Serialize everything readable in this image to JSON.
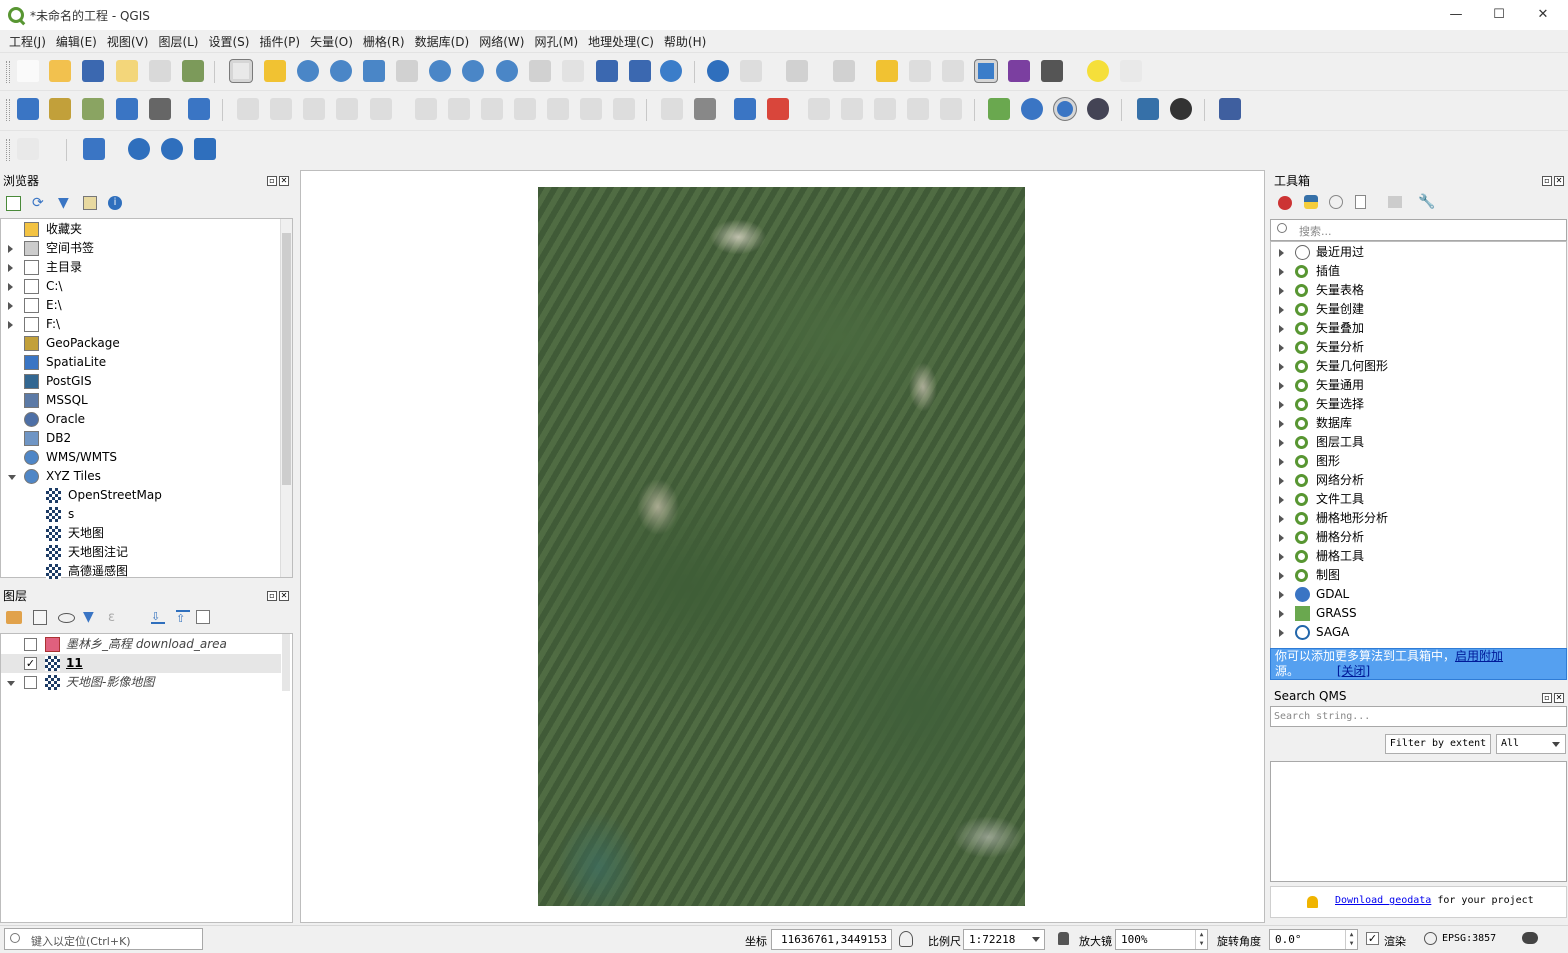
{
  "window": {
    "title": "*未命名的工程 - QGIS",
    "minimize": "—",
    "maximize": "☐",
    "close": "✕"
  },
  "menu": [
    "工程(J)",
    "编辑(E)",
    "视图(V)",
    "图层(L)",
    "设置(S)",
    "插件(P)",
    "矢量(O)",
    "栅格(R)",
    "数据库(D)",
    "网络(W)",
    "网孔(M)",
    "地理处理(C)",
    "帮助(H)"
  ],
  "browser": {
    "title": "浏览器",
    "items": [
      {
        "label": "收藏夹",
        "icon": "star-icon",
        "expand": "none"
      },
      {
        "label": "空间书签",
        "icon": "bookmark-icon",
        "expand": "collapsed"
      },
      {
        "label": "主目录",
        "icon": "home-folder-icon",
        "expand": "collapsed"
      },
      {
        "label": "C:\\",
        "icon": "folder-icon",
        "expand": "collapsed"
      },
      {
        "label": "E:\\",
        "icon": "folder-icon",
        "expand": "collapsed"
      },
      {
        "label": "F:\\",
        "icon": "folder-icon",
        "expand": "collapsed"
      },
      {
        "label": "GeoPackage",
        "icon": "geopackage-icon",
        "expand": "none"
      },
      {
        "label": "SpatiaLite",
        "icon": "spatialite-icon",
        "expand": "none"
      },
      {
        "label": "PostGIS",
        "icon": "postgis-icon",
        "expand": "none"
      },
      {
        "label": "MSSQL",
        "icon": "mssql-icon",
        "expand": "none"
      },
      {
        "label": "Oracle",
        "icon": "oracle-icon",
        "expand": "none"
      },
      {
        "label": "DB2",
        "icon": "db2-icon",
        "expand": "none"
      },
      {
        "label": "WMS/WMTS",
        "icon": "wms-globe-icon",
        "expand": "none"
      },
      {
        "label": "XYZ Tiles",
        "icon": "xyz-globe-icon",
        "expand": "expanded"
      },
      {
        "label": "OpenStreetMap",
        "icon": "tile-icon",
        "expand": "child"
      },
      {
        "label": "s",
        "icon": "tile-icon",
        "expand": "child"
      },
      {
        "label": "天地图",
        "icon": "tile-icon",
        "expand": "child"
      },
      {
        "label": "天地图注记",
        "icon": "tile-icon",
        "expand": "child"
      },
      {
        "label": "高德遥感图",
        "icon": "tile-icon",
        "expand": "child"
      }
    ]
  },
  "layers": {
    "title": "图层",
    "items": [
      {
        "label": "墨林乡_高程 download_area",
        "checked": false,
        "icon": "polygon-layer-icon",
        "style": "italic"
      },
      {
        "label": "11",
        "checked": true,
        "icon": "raster-layer-icon",
        "style": "bold"
      },
      {
        "label": "天地图-影像地图",
        "checked": false,
        "icon": "raster-layer-icon",
        "style": "italic"
      }
    ],
    "check_mark": "✓"
  },
  "toolbox": {
    "title": "工具箱",
    "search_placeholder": "搜索...",
    "items": [
      {
        "label": "最近用过",
        "icon": "clock-icon"
      },
      {
        "label": "插值",
        "icon": "qgis-icon"
      },
      {
        "label": "矢量表格",
        "icon": "qgis-icon"
      },
      {
        "label": "矢量创建",
        "icon": "qgis-icon"
      },
      {
        "label": "矢量叠加",
        "icon": "qgis-icon"
      },
      {
        "label": "矢量分析",
        "icon": "qgis-icon"
      },
      {
        "label": "矢量几何图形",
        "icon": "qgis-icon"
      },
      {
        "label": "矢量通用",
        "icon": "qgis-icon"
      },
      {
        "label": "矢量选择",
        "icon": "qgis-icon"
      },
      {
        "label": "数据库",
        "icon": "qgis-icon"
      },
      {
        "label": "图层工具",
        "icon": "qgis-icon"
      },
      {
        "label": "图形",
        "icon": "qgis-icon"
      },
      {
        "label": "网络分析",
        "icon": "qgis-icon"
      },
      {
        "label": "文件工具",
        "icon": "qgis-icon"
      },
      {
        "label": "栅格地形分析",
        "icon": "qgis-icon"
      },
      {
        "label": "栅格分析",
        "icon": "qgis-icon"
      },
      {
        "label": "栅格工具",
        "icon": "qgis-icon"
      },
      {
        "label": "制图",
        "icon": "qgis-icon"
      },
      {
        "label": "GDAL",
        "icon": "gdal-icon"
      },
      {
        "label": "GRASS",
        "icon": "grass-icon"
      },
      {
        "label": "SAGA",
        "icon": "saga-icon"
      }
    ],
    "notice_text": "你可以添加更多算法到工具箱中，",
    "notice_link": "启用附加",
    "notice_text2": "源。",
    "notice_close": "[关闭]"
  },
  "qms": {
    "title": "Search QMS",
    "search_placeholder": "Search string...",
    "filter_button": "Filter by extent",
    "filter_value": "All",
    "download_link": "Download geodata",
    "download_text": " for your project"
  },
  "status": {
    "locator_placeholder": "键入以定位(Ctrl+K)",
    "coord_label": "坐标",
    "coord_value": "11636761,3449153",
    "scale_label": "比例尺",
    "scale_value": "1:72218",
    "magnifier_label": "放大镜",
    "magnifier_value": "100%",
    "rotation_label": "旋转角度",
    "rotation_value": "0.0°",
    "render_label": "渲染",
    "crs": "EPSG:3857"
  },
  "colors": {
    "qgis_green": "#589632",
    "selection_blue": "#3399ff",
    "notice_bg": "#55a0f0"
  }
}
